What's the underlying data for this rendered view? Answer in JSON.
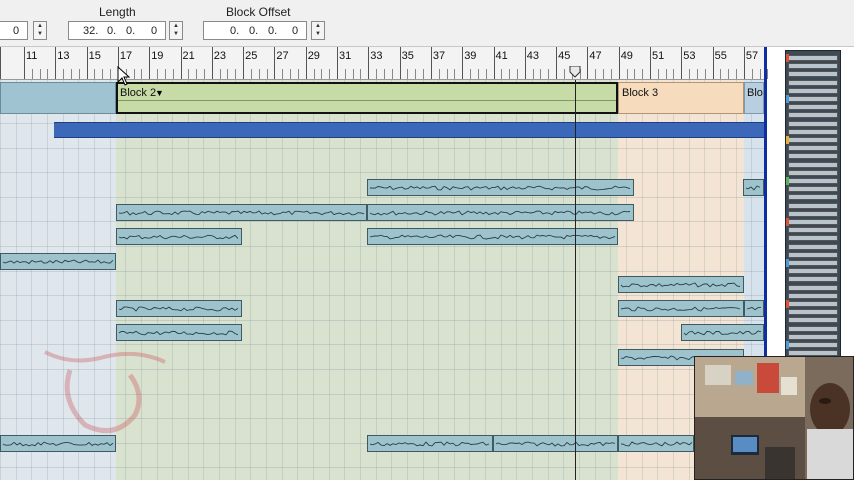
{
  "toolbar": {
    "position_value": "0",
    "length_label": "Length",
    "length_value": [
      "32.",
      "0.",
      "0.",
      "0"
    ],
    "block_offset_label": "Block Offset",
    "block_offset_value": [
      "0.",
      "0.",
      "0.",
      "0"
    ],
    "spin_up_glyph": "▲",
    "spin_down_glyph": "▼"
  },
  "ruler": {
    "bar_labels": [
      "11",
      "13",
      "15",
      "17",
      "19",
      "21",
      "23",
      "25",
      "27",
      "29",
      "31",
      "33",
      "35",
      "37",
      "39",
      "41",
      "43",
      "45",
      "47",
      "49",
      "51",
      "53",
      "55",
      "57"
    ]
  },
  "blocks": [
    {
      "name": "Block 2",
      "dropdown_glyph": "▼",
      "color": "#c7dba6"
    },
    {
      "name": "Block 3",
      "color": "#f6dcbd"
    },
    {
      "name": "Blo",
      "color": "#b8cfe0"
    }
  ],
  "colors": {
    "block_previous": "#9fc3d0",
    "block2_region": "#d9e2cf",
    "block3_region": "#f3e4d4",
    "clip_fill": "#9ec3cc",
    "automation": "#3b68b8",
    "track_border": "#0f2fa0"
  },
  "icons": {
    "playhead": "playhead-marker-icon",
    "cursor": "mouse-cursor-icon"
  }
}
